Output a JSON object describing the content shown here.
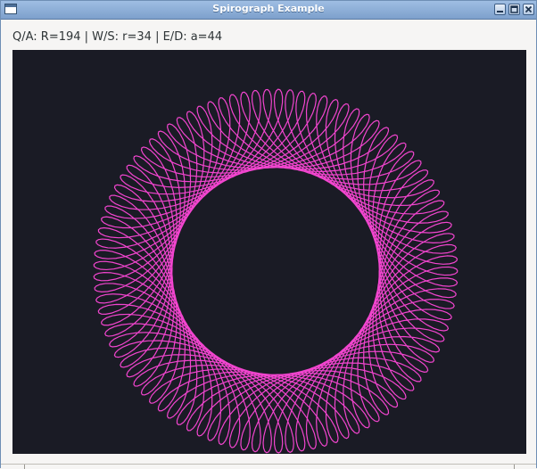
{
  "window": {
    "title": "Spirograph Example"
  },
  "status": {
    "text": "Q/A: R=194 | W/S: r=34 | E/D: a=44"
  },
  "spirograph": {
    "R": 194,
    "r": 34,
    "a": 44,
    "line_color": "#f245cf",
    "background_color": "#1a1b25"
  },
  "colors": {
    "titlebar": "#8aaad5",
    "window_bg": "#f6f5f4"
  },
  "icons": {
    "window_menu": "window-menu-icon",
    "minimize": "minimize-icon",
    "maximize": "maximize-icon",
    "close": "close-icon"
  }
}
